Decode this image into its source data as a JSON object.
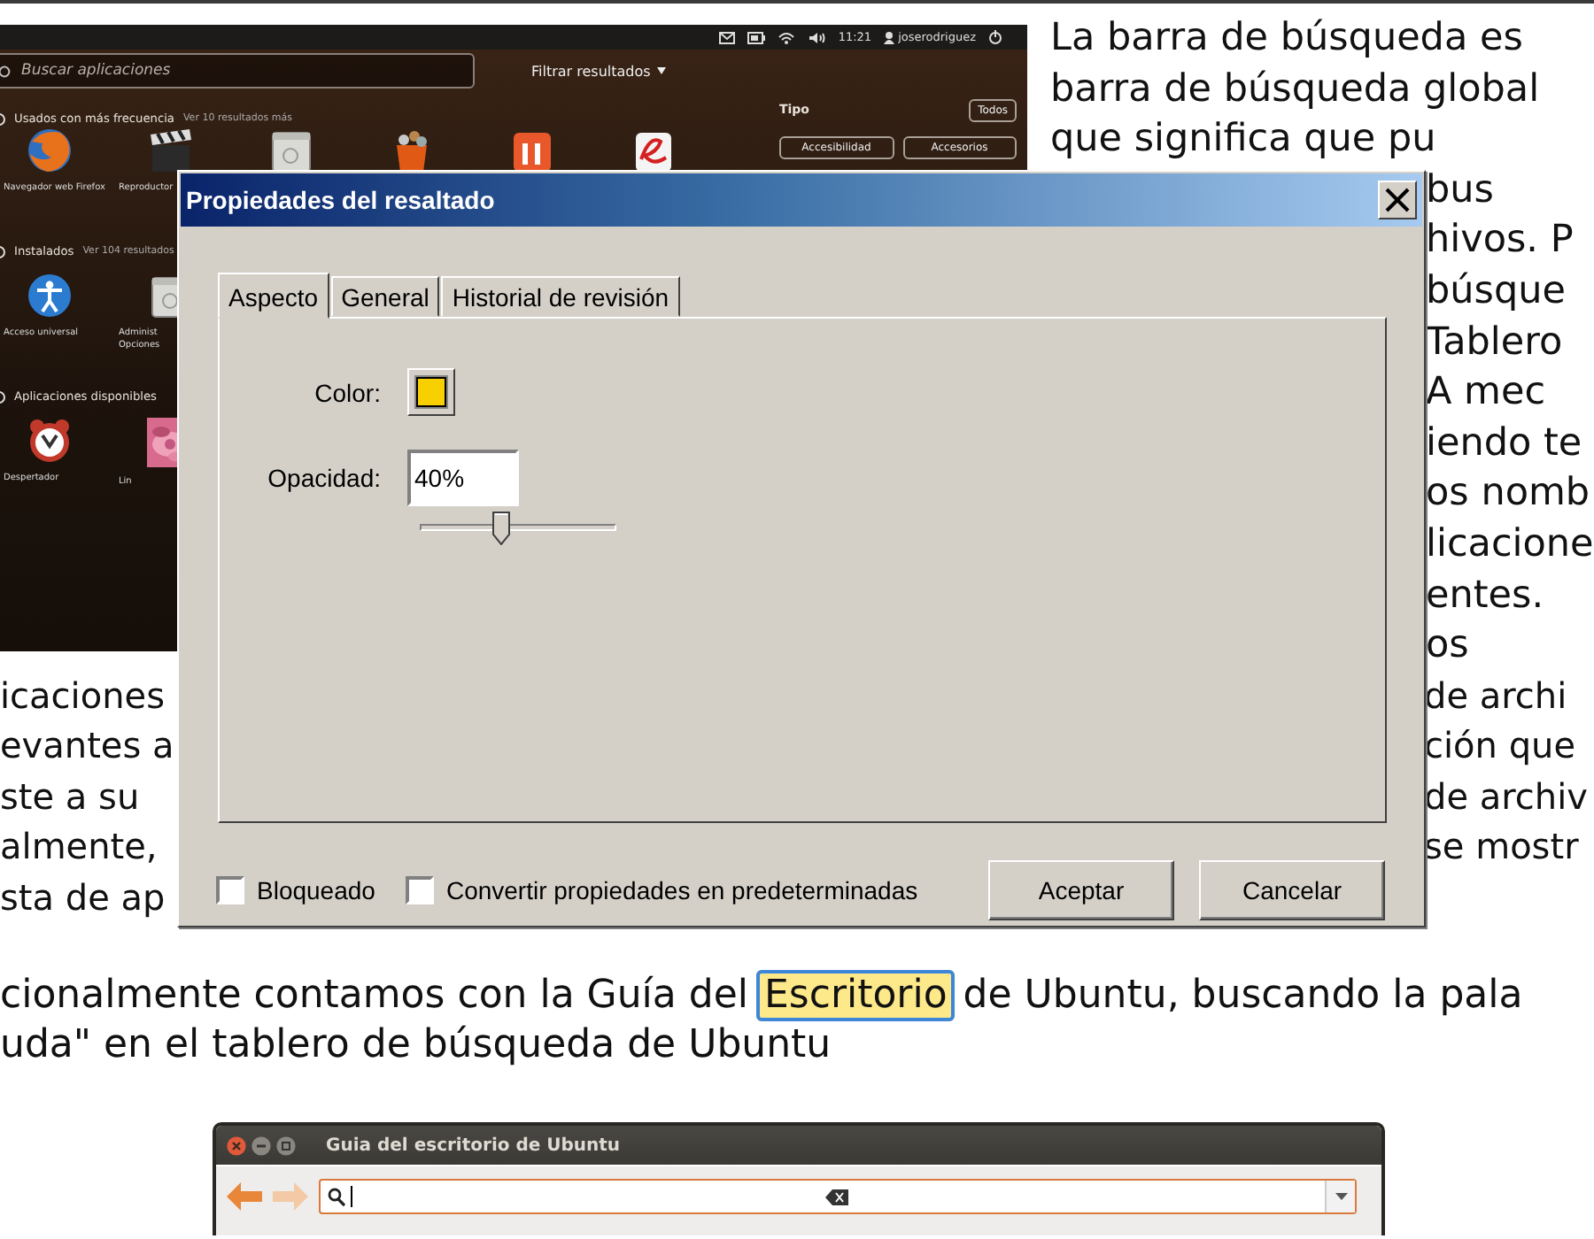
{
  "dash": {
    "panel": {
      "time": "11:21",
      "user": "joserodriguez"
    },
    "search": {
      "placeholder": "Buscar aplicaciones"
    },
    "filter": "Filtrar resultados",
    "sections": [
      {
        "title": "Usados con más frecuencia",
        "more": "Ver 10 resultados más",
        "apps": [
          {
            "kind": "globe",
            "label": "Navegador web Firefox"
          },
          {
            "kind": "clapper",
            "label": "Reproductor"
          },
          {
            "kind": "window"
          },
          {
            "kind": "bag"
          },
          {
            "kind": "orange"
          },
          {
            "kind": "curve"
          }
        ]
      },
      {
        "title": "Instalados",
        "more": "Ver 104 resultados",
        "apps": [
          {
            "kind": "person",
            "label": "Acceso universal"
          },
          {
            "kind": "window",
            "label": "Administ",
            "sublabel": "Opciones"
          }
        ]
      },
      {
        "title": "Aplicaciones disponibles",
        "apps": [
          {
            "kind": "clock",
            "label": "Despertador"
          },
          {
            "kind": "picture",
            "label": "Lin"
          }
        ]
      }
    ],
    "type_panel": {
      "title": "Tipo",
      "all": "Todos",
      "chips": [
        "Accesibilidad",
        "Accesorios"
      ]
    }
  },
  "article": {
    "side_lines": [
      {
        "text": "La barra de búsqueda es",
        "covered": false
      },
      {
        "text": "barra de búsqueda global",
        "covered": false
      },
      {
        "text": "que significa que pu",
        "covered": false
      },
      {
        "text": "bus",
        "covered": true
      },
      {
        "text": "hivos. P",
        "covered": true
      },
      {
        "text": "búsque",
        "covered": true
      },
      {
        "text": "Tablero",
        "covered": true
      },
      {
        "text": "A mec",
        "covered": true
      },
      {
        "text": "iendo te",
        "covered": true
      },
      {
        "text": "os nomb",
        "covered": true
      },
      {
        "text": "licacione",
        "covered": true
      },
      {
        "text": "entes.",
        "covered": true
      },
      {
        "text": "os",
        "covered": true
      }
    ],
    "lines": [
      {
        "left": "icaciones",
        "right": "de archi"
      },
      {
        "left": "evantes a",
        "right": "ción que"
      },
      {
        "left": "ste a su",
        "right": "de archiv"
      },
      {
        "left": "almente,",
        "right": "se mostr"
      },
      {
        "left": "sta de ap"
      }
    ],
    "paragraph": [
      [
        {
          "text": "cionalmente contamos con la Guía del ",
          "highlight": false
        },
        {
          "text": "Escritorio",
          "highlight": true
        },
        {
          "text": " de Ubuntu, buscando la pala",
          "highlight": false
        }
      ],
      [
        {
          "text": "uda\" en el tablero de búsqueda de Ubuntu",
          "highlight": false
        }
      ]
    ]
  },
  "help_window": {
    "title": "Guia del escritorio de Ubuntu",
    "back": {
      "disabled": false
    },
    "forward": {
      "disabled": true
    }
  },
  "dialog": {
    "title": "Propiedades del resaltado",
    "tabs": [
      {
        "label": "Aspecto",
        "selected": true
      },
      {
        "label": "General",
        "selected": false
      },
      {
        "label": "Historial de revisión",
        "selected": false
      }
    ],
    "color_label": "Color:",
    "color": "#f8d000",
    "opacity_label": "Opacidad:",
    "opacity_value": "40%",
    "opacity_slider": {
      "level": 0.41
    },
    "checkboxes": [
      {
        "label": "Bloqueado",
        "checked": false
      },
      {
        "label": "Convertir propiedades en predeterminadas",
        "checked": false
      }
    ],
    "buttons": [
      "Aceptar",
      "Cancelar"
    ]
  }
}
